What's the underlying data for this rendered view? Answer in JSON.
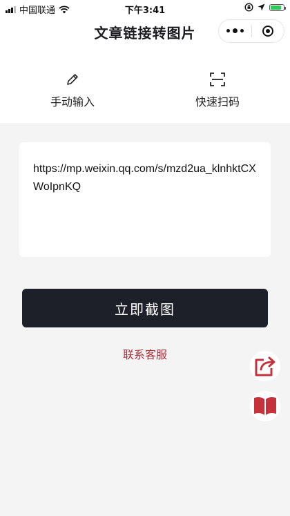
{
  "status_bar": {
    "carrier": "中国联通",
    "time": "下午3:41",
    "battery_level": 0.85,
    "icons": [
      "signal-icon",
      "wifi-icon",
      "orientation-lock-icon",
      "location-icon",
      "battery-icon"
    ],
    "battery_color": "#34c759"
  },
  "nav": {
    "title": "文章链接转图片",
    "capsule_icons": [
      "more-dots-icon",
      "close-target-icon"
    ]
  },
  "tabs": [
    {
      "label": "手动输入",
      "icon": "pencil-icon"
    },
    {
      "label": "快速扫码",
      "icon": "scan-icon"
    }
  ],
  "input": {
    "value": "https://mp.weixin.qq.com/s/mzd2ua_klnhktCXWoIpnKQ"
  },
  "actions": {
    "primary_label": "立即截图",
    "contact_label": "联系客服"
  },
  "floating": {
    "share_icon": "share-icon",
    "book_icon": "book-icon"
  },
  "colors": {
    "primary_button": "#1d2029",
    "accent_red": "#a8313c",
    "icon_red": "#c6323c",
    "background": "#f4f4f4"
  }
}
